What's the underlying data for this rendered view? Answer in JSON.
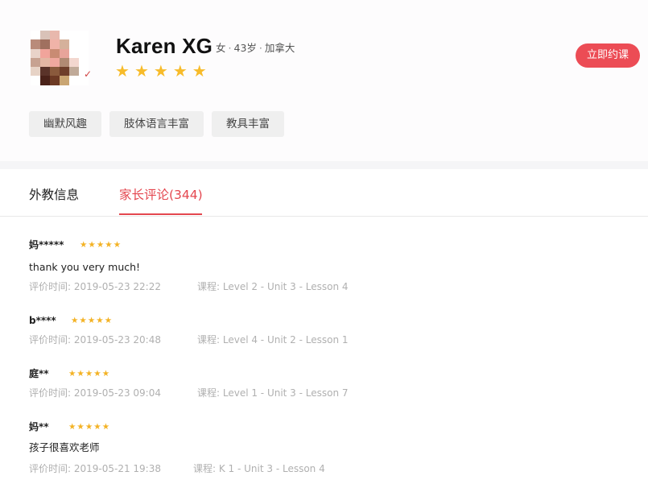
{
  "teacher": {
    "name": "Karen XG",
    "gender": "女",
    "age": "43岁",
    "country": "加拿大",
    "rating": 5
  },
  "book_button": "立即约课",
  "tags": [
    "幽默风趣",
    "肢体语言丰富",
    "教具丰富"
  ],
  "tabs": [
    {
      "label": "外教信息",
      "active": false
    },
    {
      "label": "家长评论(344)",
      "active": true
    }
  ],
  "reviews": [
    {
      "user": "妈*****",
      "rating": 5,
      "comment": "thank you very much!",
      "time": "评价时间: 2019-05-23 22:22",
      "course": "课程: Level 2 - Unit 3 - Lesson 4"
    },
    {
      "user": "b****",
      "rating": 5,
      "comment": "",
      "time": "评价时间: 2019-05-23 20:48",
      "course": "课程: Level 4 - Unit 2 - Lesson 1"
    },
    {
      "user": "庭**",
      "rating": 5,
      "comment": "",
      "time": "评价时间: 2019-05-23 09:04",
      "course": "课程: Level 1 - Unit 3 - Lesson 7"
    },
    {
      "user": "妈**",
      "rating": 5,
      "comment": "孩子很喜欢老师",
      "time": "评价时间: 2019-05-21 19:38",
      "course": "课程: K 1 - Unit 3 - Lesson 4"
    }
  ],
  "colors": {
    "accent": "#e4474f",
    "button": "#ec4c55",
    "star": "#f7bb2a",
    "muted_text": "#b0b0b0"
  },
  "icons": {
    "star": "star-icon",
    "avatar": "pixelated-avatar"
  }
}
